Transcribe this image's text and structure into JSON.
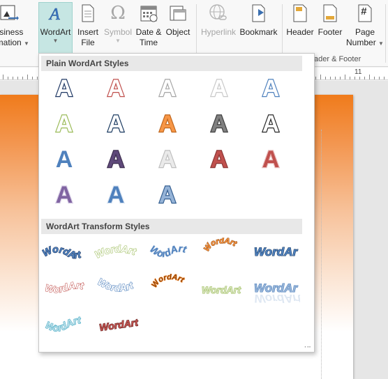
{
  "ribbon": {
    "buttons": [
      {
        "name": "business-information-button",
        "lines": [
          "usiness",
          "ormation"
        ],
        "icon": "business-info-icon",
        "dropdown": true
      },
      {
        "name": "wordart-button",
        "lines": [
          "WordArt"
        ],
        "icon": "wordart-icon",
        "dropdown": true,
        "active": true
      },
      {
        "name": "insert-file-button",
        "lines": [
          "Insert",
          "File"
        ],
        "icon": "insert-file-icon",
        "dropdown": false
      },
      {
        "name": "symbol-button",
        "lines": [
          "Symbol"
        ],
        "icon": "omega-icon",
        "dropdown": true,
        "disabled": true
      },
      {
        "name": "date-time-button",
        "lines": [
          "Date &",
          "Time"
        ],
        "icon": "calendar-icon",
        "dropdown": false
      },
      {
        "name": "object-button",
        "lines": [
          "Object"
        ],
        "icon": "object-icon",
        "dropdown": false
      },
      {
        "name": "hyperlink-button",
        "lines": [
          "Hyperlink"
        ],
        "icon": "globe-link-icon",
        "dropdown": false,
        "disabled": true
      },
      {
        "name": "bookmark-button",
        "lines": [
          "Bookmark"
        ],
        "icon": "bookmark-icon",
        "dropdown": false
      },
      {
        "name": "header-button",
        "lines": [
          "Header"
        ],
        "icon": "header-icon",
        "dropdown": false
      },
      {
        "name": "footer-button",
        "lines": [
          "Footer"
        ],
        "icon": "footer-icon",
        "dropdown": false
      },
      {
        "name": "page-number-button",
        "lines": [
          "Page",
          "Number"
        ],
        "icon": "page-number-icon",
        "dropdown": true
      }
    ],
    "group_label_header_footer": "ader & Footer",
    "page_number_glyph": "#"
  },
  "ruler": {
    "visible_number": "11"
  },
  "gallery": {
    "plain_header": "Plain WordArt Styles",
    "transform_header": "WordArt Transform Styles",
    "plain_letter": "A",
    "transform_text": "WordArt",
    "plain_styles": [
      {
        "fill": "#ffffff",
        "stroke": "#1f3864"
      },
      {
        "fill": "#ffffff",
        "stroke": "#c0504d"
      },
      {
        "fill": "#ffffff",
        "stroke": "#a6a6a6"
      },
      {
        "fill": "#ffffff",
        "stroke": "#c9c9c9"
      },
      {
        "fill": "#ffffff",
        "stroke": "#4f81bd"
      },
      {
        "fill": "#ffffff",
        "stroke": "#9bbb59"
      },
      {
        "fill": "#ffffff",
        "stroke": "#17375e"
      },
      {
        "fill": "#f79646",
        "stroke": "#c0681f"
      },
      {
        "fill": "#808080",
        "stroke": "#404040"
      },
      {
        "fill": "#ffffff",
        "stroke": "#262626"
      },
      {
        "fill": "#4f81bd",
        "stroke": "#ffffff"
      },
      {
        "fill": "#5f497a",
        "stroke": "#3f3151"
      },
      {
        "fill": "#eaeaea",
        "stroke": "#bfbfbf"
      },
      {
        "fill": "#c0504d",
        "stroke": "#8c3836"
      },
      {
        "fill": "#c0504d",
        "stroke": "#e6b9b8"
      },
      {
        "fill": "#8064a2",
        "stroke": "#d9d0e6"
      },
      {
        "fill": "#4f81bd",
        "stroke": "#dbe5f1"
      },
      {
        "fill": "#95b3d7",
        "stroke": "#366092"
      }
    ],
    "transform_styles": [
      {
        "fill": "#4f81bd",
        "stroke": "#1f3864",
        "effect": "wave"
      },
      {
        "fill": "#ffffff",
        "stroke": "#9bbb59",
        "effect": "arch-up"
      },
      {
        "fill": "#4f81bd",
        "stroke": "#b8cce4",
        "effect": "wave-down"
      },
      {
        "fill": "#f79646",
        "stroke": "#974806",
        "effect": "circle"
      },
      {
        "fill": "#4f81bd",
        "stroke": "#17375e",
        "effect": "bulge"
      },
      {
        "fill": "#ffffff",
        "stroke": "#c0504d",
        "effect": "flag"
      },
      {
        "fill": "#ffffff",
        "stroke": "#4f81bd",
        "effect": "arch-down"
      },
      {
        "fill": "#984807",
        "stroke": "#f79646",
        "effect": "ring"
      },
      {
        "fill": "#d7e4bc",
        "stroke": "#9bbb59",
        "effect": "plain"
      },
      {
        "fill": "#95b3d7",
        "stroke": "#4f81bd",
        "effect": "reflect"
      },
      {
        "fill": "#b7dee8",
        "stroke": "#4bacc6",
        "effect": "wave-light"
      },
      {
        "fill": "#c0504d",
        "stroke": "#632523",
        "effect": "slant"
      }
    ]
  }
}
